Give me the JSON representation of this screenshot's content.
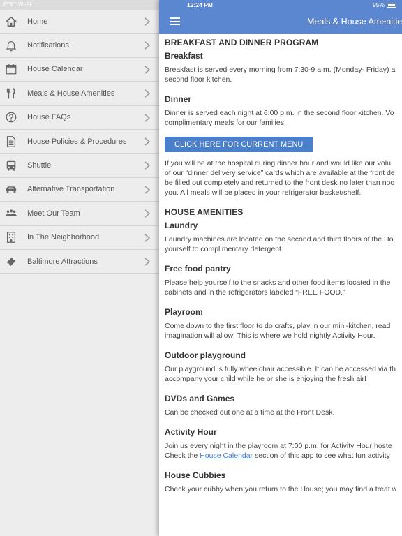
{
  "sidebar": {
    "carrier": "AT&T Wi-Fi",
    "items": [
      {
        "label": "Home",
        "icon": "home-icon"
      },
      {
        "label": "Notifications",
        "icon": "bell-icon"
      },
      {
        "label": "House Calendar",
        "icon": "calendar-icon"
      },
      {
        "label": "Meals & House Amenities",
        "icon": "fork-knife-icon"
      },
      {
        "label": "House FAQs",
        "icon": "question-icon"
      },
      {
        "label": "House Policies & Procedures",
        "icon": "document-icon"
      },
      {
        "label": "Shuttle",
        "icon": "bus-icon"
      },
      {
        "label": "Alternative Transportation",
        "icon": "car-icon"
      },
      {
        "label": "Meet Our Team",
        "icon": "team-icon"
      },
      {
        "label": "In The Neighborhood",
        "icon": "building-icon"
      },
      {
        "label": "Baltimore Attractions",
        "icon": "ticket-icon"
      }
    ]
  },
  "status": {
    "time": "12:24 PM",
    "battery": "95%",
    "battery_level": 0.95
  },
  "navbar": {
    "title": "Meals & House Amenities"
  },
  "content": {
    "program_heading": "BREAKFAST AND DINNER PROGRAM",
    "breakfast_heading": "Breakfast",
    "breakfast_lines": [
      "Breakfast is served every morning from 7:30-9 a.m. (Monday- Friday) a",
      "second floor kitchen."
    ],
    "dinner_heading": "Dinner",
    "dinner_lines": [
      "Dinner is served each night at 6:00 p.m. in the second floor kitchen. Vo",
      "complimentary meals for our families."
    ],
    "menu_button": "CLICK HERE FOR CURRENT MENU",
    "delivery_lines": [
      "If you will be at the hospital during dinner hour and would like our volu",
      "of our “dinner delivery service” cards which are available at the front de",
      "be filled out completely and returned to the front desk no later than noo",
      "you. All meals will be placed in your refrigerator basket/shelf."
    ],
    "amenities_heading": "HOUSE AMENITIES",
    "laundry_heading": "Laundry",
    "laundry_lines": [
      "Laundry machines are located on the second and third floors of the Ho",
      "yourself to complimentary detergent."
    ],
    "pantry_heading": "Free food pantry",
    "pantry_lines": [
      "Please help yourself to the snacks and other food items located in the",
      "cabinets and in the refrigerators labeled “FREE FOOD.”"
    ],
    "playroom_heading": "Playroom",
    "playroom_lines": [
      "Come down to the first floor to do crafts, play in our mini-kitchen, read",
      "imagination will allow! This is where we hold nightly Activity Hour."
    ],
    "playground_heading": "Outdoor playground",
    "playground_lines": [
      "Our playground is fully wheelchair accessible. It can be accessed via th",
      "accompany your child while he or she is enjoying the fresh air!"
    ],
    "dvd_heading": "DVDs and Games",
    "dvd_line": "Can be checked out one at a time at the Front Desk.",
    "activity_heading": "Activity Hour",
    "activity_line1": "Join us every night in the playroom at 7:00 p.m. for Activity Hour hoste",
    "activity_line2_pre": "Check the ",
    "activity_link": "House Calendar",
    "activity_line2_post": " section of this app to see what fun activity",
    "cubbies_heading": "House Cubbies",
    "cubbies_line": "Check your cubby when you return to the House; you may find a treat w"
  }
}
